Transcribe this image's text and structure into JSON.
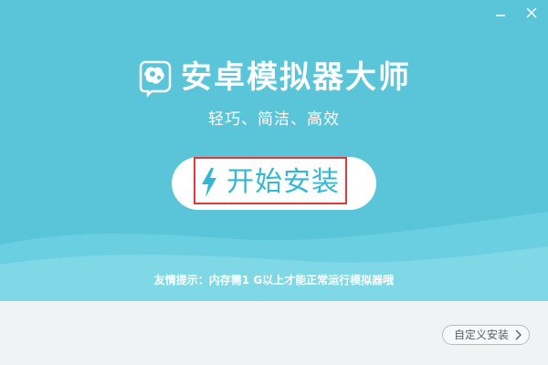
{
  "window": {
    "controls": [
      {
        "name": "minimize",
        "icon": "minimize-icon"
      },
      {
        "name": "close",
        "icon": "close-icon"
      }
    ]
  },
  "brand": {
    "title": "安卓模拟器大师",
    "logo_icon": "gear-head-logo-icon"
  },
  "tagline": "轻巧、简洁、高效",
  "install": {
    "label": "开始安装",
    "icon": "lightning-bolt-icon"
  },
  "tip": "友情提示：内存需1 G以上才能正常运行模拟器哦",
  "custom_install": {
    "label": "自定义安装",
    "icon": "chevron-right-icon"
  },
  "colors": {
    "hero_background": "#5ac4d8",
    "wave_light": "#7fd8e6",
    "footer_background": "#f1f2f4",
    "install_text": "#33b8d2",
    "highlight_border": "#e43838"
  }
}
